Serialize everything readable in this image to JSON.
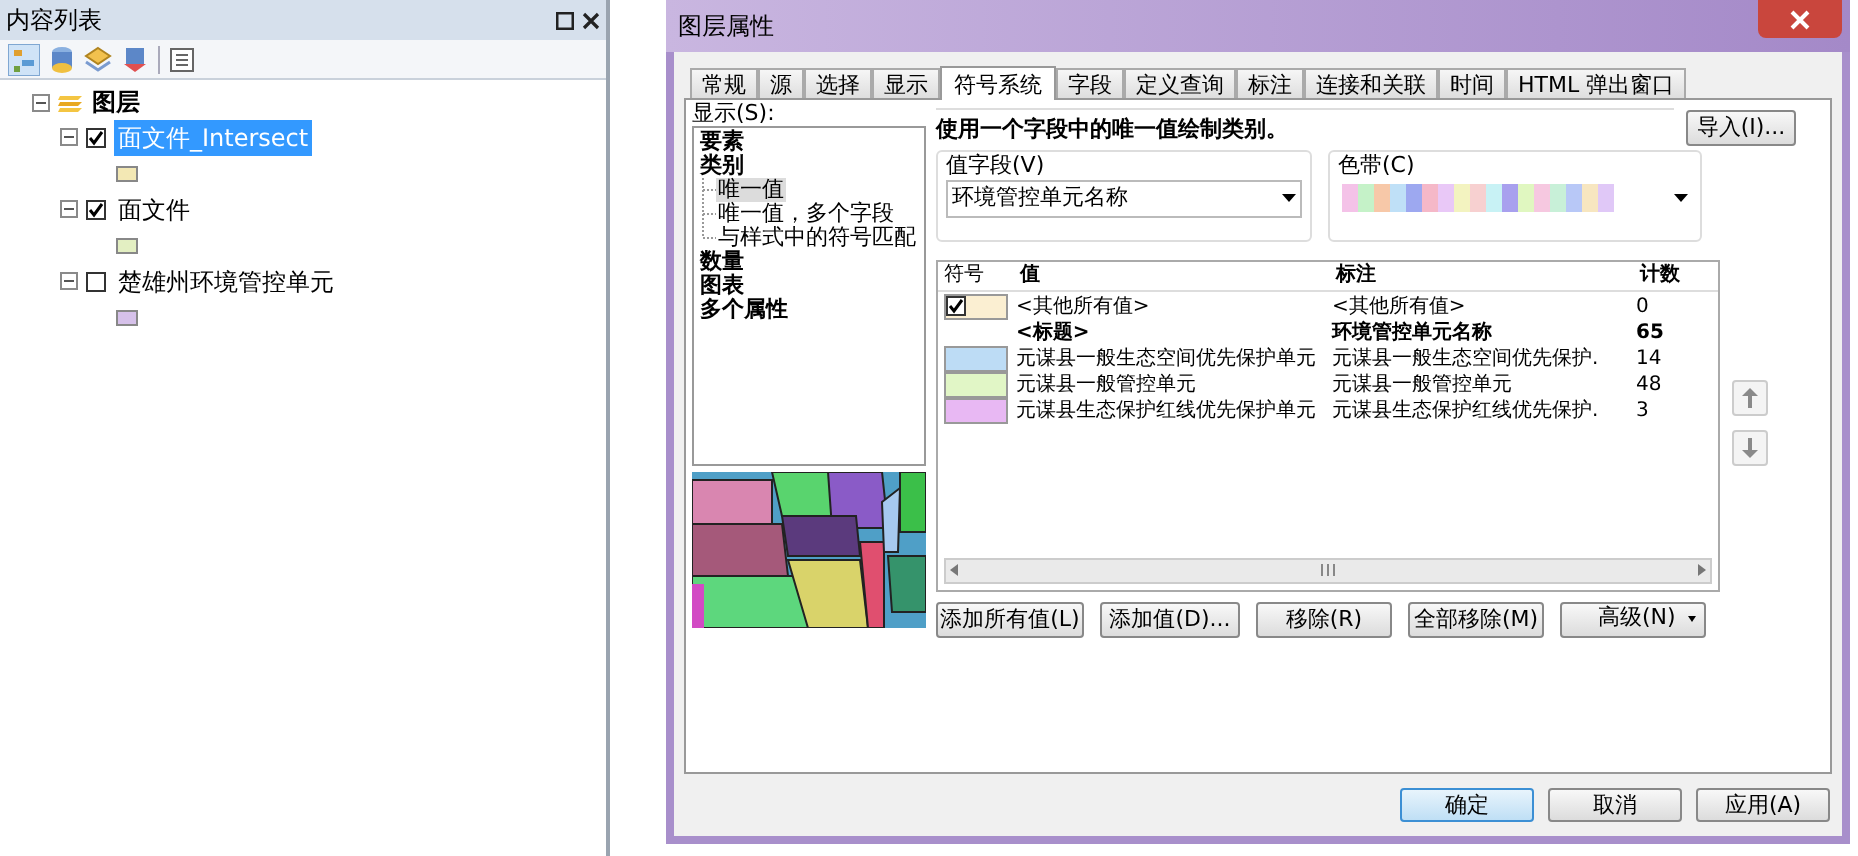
{
  "toc": {
    "title": "内容列表",
    "tree": [
      {
        "label": "图层",
        "expanded": true,
        "children": [
          {
            "label": "面文件_Intersect",
            "checked": true,
            "selected": true,
            "expanded": true,
            "color": "#f3e8b4"
          },
          {
            "label": "面文件",
            "checked": true,
            "selected": false,
            "expanded": true,
            "color": "#e3efc2"
          },
          {
            "label": "楚雄州环境管控单元",
            "checked": false,
            "selected": false,
            "expanded": true,
            "color": "#d6c1ea"
          }
        ]
      }
    ]
  },
  "dialog": {
    "title": "图层属性",
    "tabs": [
      {
        "label": "常规",
        "selected": false
      },
      {
        "label": "源",
        "selected": false
      },
      {
        "label": "选择",
        "selected": false
      },
      {
        "label": "显示",
        "selected": false
      },
      {
        "label": "符号系统",
        "selected": true
      },
      {
        "label": "字段",
        "selected": false
      },
      {
        "label": "定义查询",
        "selected": false
      },
      {
        "label": "标注",
        "selected": false
      },
      {
        "label": "连接和关联",
        "selected": false
      },
      {
        "label": "时间",
        "selected": false
      },
      {
        "label": "HTML 弹出窗口",
        "selected": false
      }
    ],
    "show_label": "显示(S):",
    "renderers": [
      {
        "label": "要素"
      },
      {
        "label": "类别",
        "children": [
          {
            "label": "唯一值",
            "selected": true
          },
          {
            "label": "唯一值，多个字段",
            "selected": false
          },
          {
            "label": "与样式中的符号匹配",
            "selected": false
          }
        ]
      },
      {
        "label": "数量"
      },
      {
        "label": "图表"
      },
      {
        "label": "多个属性"
      }
    ],
    "description": "使用一个字段中的唯一值绘制类别。",
    "import_button": "导入(I)...",
    "value_field": {
      "label": "值字段(V)",
      "value": "环境管控单元名称"
    },
    "color_ramp": {
      "label": "色带(C)"
    },
    "table": {
      "columns": [
        "符号",
        "值",
        "标注",
        "计数"
      ],
      "rows": [
        {
          "kind": "other",
          "checked": true,
          "color": "#fbefd2",
          "category": "<其他所有值>",
          "annotation": "<其他所有值>",
          "count": "0"
        },
        {
          "kind": "heading",
          "category": "<标题>",
          "annotation": "环境管控单元名称",
          "count": "65"
        },
        {
          "kind": "value",
          "color": "#bddcf5",
          "category": "元谋县一般生态空间优先保护单元",
          "annotation": "元谋县一般生态空间优先保护.",
          "count": "14"
        },
        {
          "kind": "value",
          "color": "#e1f6c6",
          "category": "元谋县一般管控单元",
          "annotation": "元谋县一般管控单元",
          "count": "48"
        },
        {
          "kind": "value",
          "color": "#e8b8f3",
          "category": "元谋县生态保护红线优先保护单元",
          "annotation": "元谋县生态保护红线优先保护.",
          "count": "3"
        }
      ]
    },
    "table_buttons": [
      "添加所有值(L)",
      "添加值(D)...",
      "移除(R)",
      "全部移除(M)"
    ],
    "advanced_button": "高级(N)",
    "footer_buttons": [
      {
        "label": "确定",
        "default": true
      },
      {
        "label": "取消",
        "default": false
      },
      {
        "label": "应用(A)",
        "default": false
      }
    ]
  }
}
